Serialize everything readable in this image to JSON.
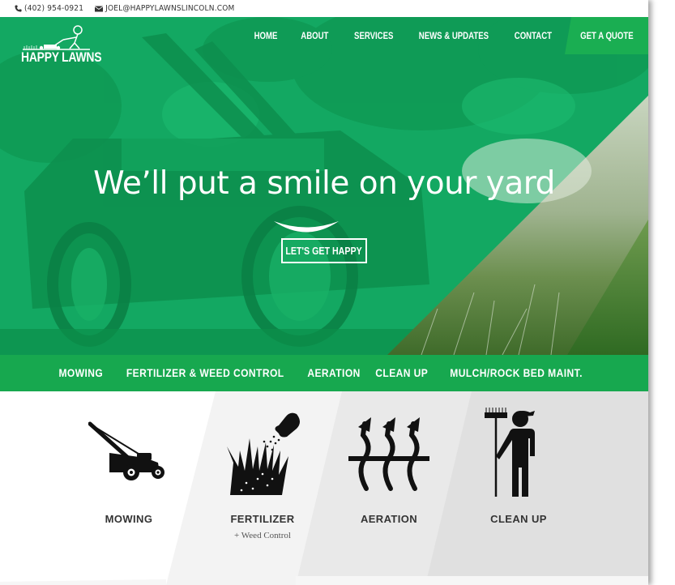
{
  "topbar": {
    "phone": "(402) 954-0921",
    "email": "JOEL@HAPPYLAWNSLINCOLN.COM"
  },
  "brand": {
    "name": "HAPPY LAWNS",
    "green": "#12a85e",
    "accent": "#1aae52"
  },
  "nav": {
    "items": [
      {
        "label": "HOME"
      },
      {
        "label": "ABOUT"
      },
      {
        "label": "SERVICES"
      },
      {
        "label": "NEWS & UPDATES"
      },
      {
        "label": "CONTACT"
      }
    ],
    "quote_label": "GET A QUOTE"
  },
  "hero": {
    "title": "We’ll put a smile on your yard",
    "cta_label": "LET'S GET HAPPY"
  },
  "service_strip": {
    "items": [
      {
        "label": "MOWING"
      },
      {
        "label": "FERTILIZER & WEED CONTROL"
      },
      {
        "label": "AERATION"
      },
      {
        "label": "CLEAN UP"
      },
      {
        "label": "MULCH/ROCK BED MAINT."
      }
    ]
  },
  "services": [
    {
      "label": "MOWING",
      "sub": "",
      "icon": "lawnmower-icon"
    },
    {
      "label": "FERTILIZER",
      "sub": "+ Weed Control",
      "icon": "fertilizer-icon"
    },
    {
      "label": "AERATION",
      "sub": "",
      "icon": "aeration-icon"
    },
    {
      "label": "CLEAN UP",
      "sub": "",
      "icon": "rake-worker-icon"
    }
  ]
}
